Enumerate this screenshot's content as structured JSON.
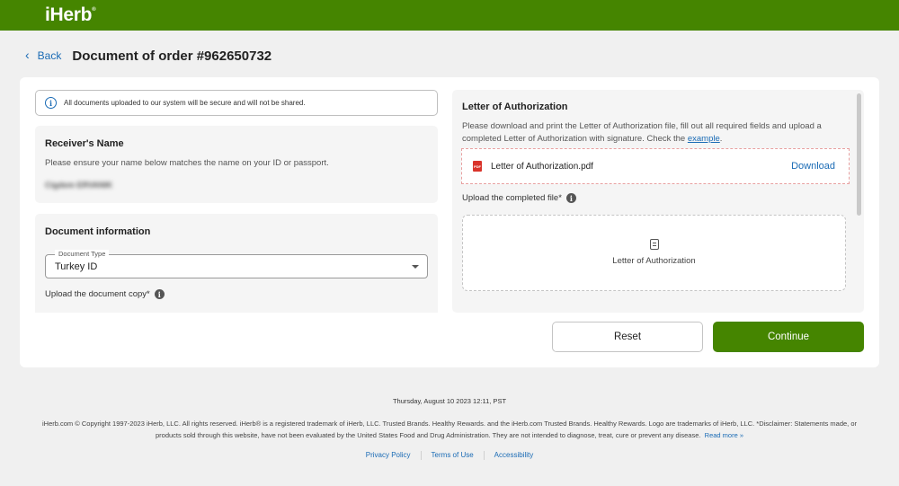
{
  "header": {
    "logo": "iHerb"
  },
  "titlebar": {
    "back_label": "Back",
    "title": "Document of order #962650732"
  },
  "notice": {
    "text": "All documents uploaded to our system will be secure and will not be shared."
  },
  "receiver": {
    "title": "Receiver's Name",
    "instruction": "Please ensure your name below matches the name on your ID or passport.",
    "name": "Cigdem ERVANIK"
  },
  "document_info": {
    "title": "Document information",
    "type_label": "Document Type",
    "type_value": "Turkey ID",
    "upload_label": "Upload the document copy*"
  },
  "authorization": {
    "title": "Letter of Authorization",
    "text_before_link": "Please download and print the Letter of Authorization file, fill out all required fields and upload a completed Letter of Authorization with signature. Check the ",
    "link_text": "example",
    "text_after_link": ".",
    "file_name": "Letter of Authorization.pdf",
    "pdf_badge": "PDF",
    "download_label": "Download",
    "upload_label": "Upload the completed file*",
    "dropzone_text": "Letter of Authorization"
  },
  "buttons": {
    "reset": "Reset",
    "continue": "Continue"
  },
  "footer": {
    "date": "Thursday, August 10 2023 12:11, PST",
    "copyright": "iHerb.com © Copyright 1997-2023 iHerb, LLC. All rights reserved. iHerb® is a registered trademark of iHerb, LLC. Trusted Brands. Healthy Rewards. and the iHerb.com Trusted Brands. Healthy Rewards. Logo are trademarks of iHerb, LLC. *Disclaimer: Statements made, or products sold through this website, have not been evaluated by the United States Food and Drug Administration. They are not intended to diagnose, treat, cure or prevent any disease.",
    "read_more": "Read more »",
    "links": [
      "Privacy Policy",
      "Terms of Use",
      "Accessibility"
    ]
  },
  "colors": {
    "brand_green": "#458500",
    "link_blue": "#1a6bb5"
  }
}
